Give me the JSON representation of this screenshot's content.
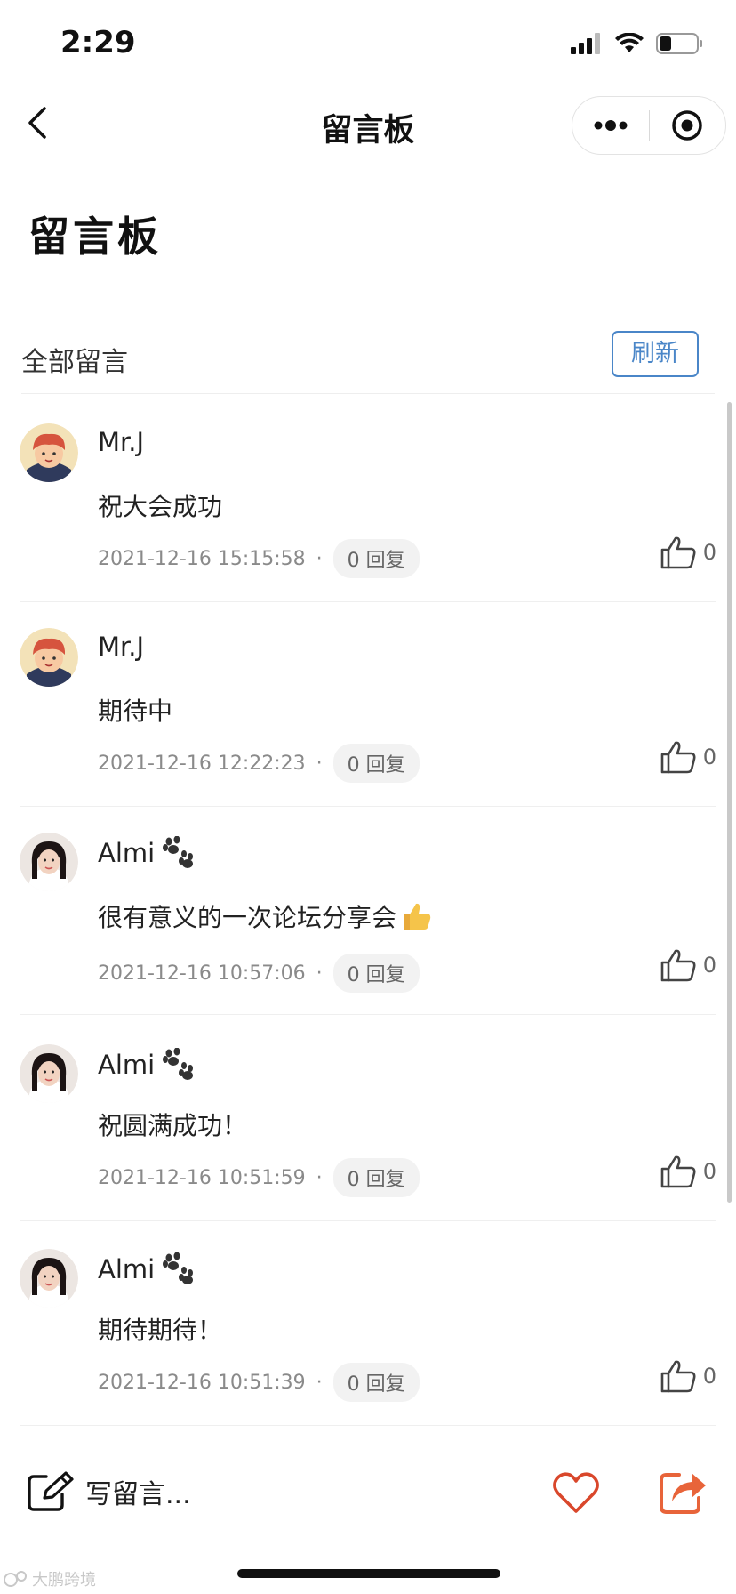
{
  "status_bar": {
    "time": "2:29"
  },
  "nav": {
    "title": "留言板"
  },
  "page": {
    "heading": "留言板"
  },
  "section": {
    "title": "全部留言",
    "refresh_label": "刷新"
  },
  "comments": [
    {
      "username": "Mr.J",
      "paw": false,
      "text": "祝大会成功",
      "time": "2021-12-16 15:15:58",
      "replies": "0 回复",
      "likes": "0",
      "avatar": "boy-cartoon"
    },
    {
      "username": "Mr.J",
      "paw": false,
      "text": "期待中",
      "time": "2021-12-16 12:22:23",
      "replies": "0 回复",
      "likes": "0",
      "avatar": "boy-cartoon"
    },
    {
      "username": "Almi",
      "paw": true,
      "text": "很有意义的一次论坛分享会",
      "thumb": true,
      "time": "2021-12-16 10:57:06",
      "replies": "0 回复",
      "likes": "0",
      "avatar": "girl-photo"
    },
    {
      "username": "Almi",
      "paw": true,
      "text": "祝圆满成功！",
      "time": "2021-12-16 10:51:59",
      "replies": "0 回复",
      "likes": "0",
      "avatar": "girl-photo"
    },
    {
      "username": "Almi",
      "paw": true,
      "text": "期待期待！",
      "time": "2021-12-16 10:51:39",
      "replies": "0 回复",
      "likes": "0",
      "avatar": "girl-photo"
    }
  ],
  "bottom_bar": {
    "write_label": "写留言..."
  },
  "watermark": {
    "text": "大鹏跨境"
  },
  "colors": {
    "accent_blue": "#4a86c8",
    "heart_red": "#d9472b",
    "share_orange": "#e8643a"
  }
}
